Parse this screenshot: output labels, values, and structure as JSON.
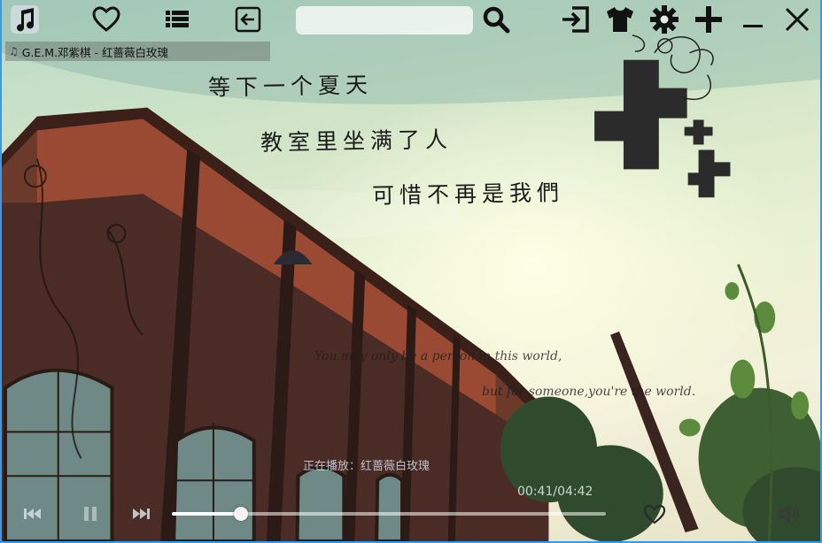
{
  "toolbar": {
    "search": {
      "value": "",
      "placeholder": ""
    }
  },
  "now_playing": {
    "title": "G.E.M.邓紫棋 - 红蔷薇白玫瑰"
  },
  "lyrics": [
    "等下一个夏天",
    "教室里坐满了人",
    "可惜不再是我們"
  ],
  "wallpaper_quote": {
    "line1": "You may only be a person in this world,",
    "line2": "but for someone,you're the world."
  },
  "status": {
    "text": "正在播放：红蔷薇白玫瑰",
    "time": "00:41/04:42"
  },
  "progress": {
    "fraction": 0.16
  },
  "colors": {
    "window_border": "#3a9ae8",
    "icon_color": "#111111",
    "control_color": "#d8dde3"
  }
}
